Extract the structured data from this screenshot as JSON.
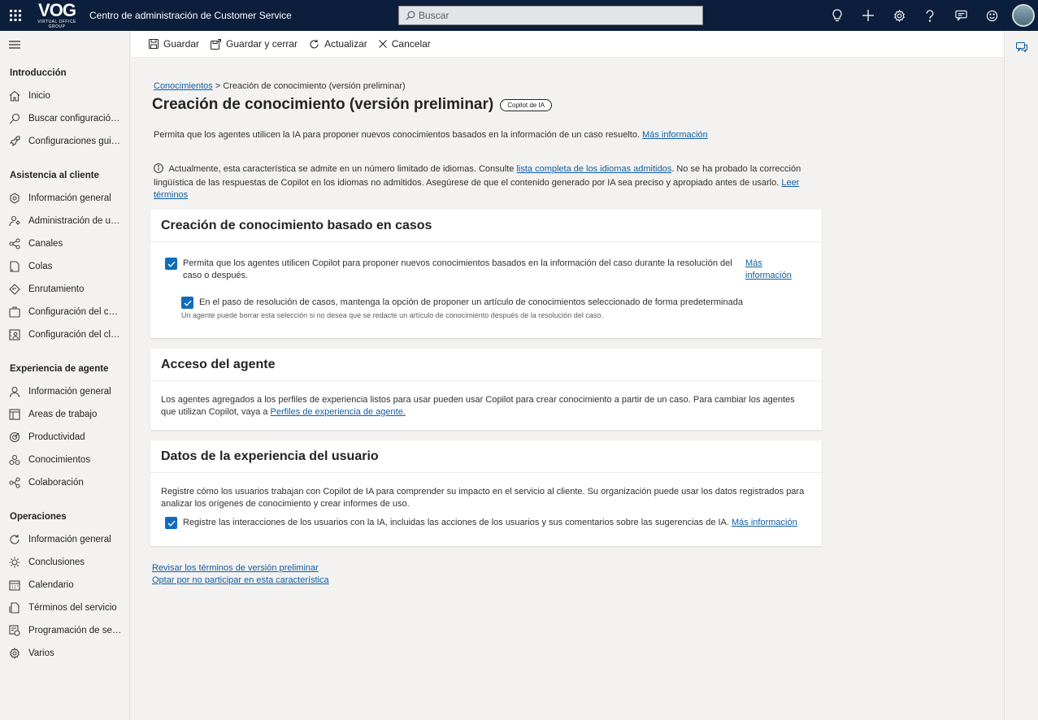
{
  "topbar": {
    "logo_text": "VOG",
    "logo_sub": "VIRTUAL OFFICE GROUP",
    "app_title": "Centro de administración de Customer Service",
    "search_placeholder": "Buscar",
    "icons": [
      "lightbulb-icon",
      "plus-icon",
      "gear-icon",
      "help-icon",
      "chat-icon",
      "smiley-icon"
    ]
  },
  "sidebar": {
    "groups": [
      {
        "title": "Introducción",
        "items": [
          {
            "label": "Inicio",
            "icon": "home-icon"
          },
          {
            "label": "Buscar configuración…",
            "icon": "search-icon"
          },
          {
            "label": "Configuraciones guiadas",
            "icon": "rocket-icon"
          }
        ]
      },
      {
        "title": "Asistencia al cliente",
        "items": [
          {
            "label": "Información general",
            "icon": "overview-icon"
          },
          {
            "label": "Administración de usuarios",
            "icon": "users-icon"
          },
          {
            "label": "Canales",
            "icon": "channels-icon"
          },
          {
            "label": "Colas",
            "icon": "queue-icon"
          },
          {
            "label": "Enrutamiento",
            "icon": "routing-icon"
          },
          {
            "label": "Configuración del caso",
            "icon": "case-icon"
          },
          {
            "label": "Configuración del cliente",
            "icon": "customer-icon"
          }
        ]
      },
      {
        "title": "Experiencia de agente",
        "items": [
          {
            "label": "Información general",
            "icon": "person-icon"
          },
          {
            "label": "Áreas de trabajo",
            "icon": "workspace-icon"
          },
          {
            "label": "Productividad",
            "icon": "productivity-icon"
          },
          {
            "label": "Conocimientos",
            "icon": "knowledge-icon"
          },
          {
            "label": "Colaboración",
            "icon": "collaboration-icon"
          }
        ]
      },
      {
        "title": "Operaciones",
        "items": [
          {
            "label": "Información general",
            "icon": "refresh-icon"
          },
          {
            "label": "Conclusiones",
            "icon": "insights-icon"
          },
          {
            "label": "Calendario",
            "icon": "calendar-icon"
          },
          {
            "label": "Términos del servicio",
            "icon": "terms-icon"
          },
          {
            "label": "Programación de servicios",
            "icon": "schedule-icon"
          },
          {
            "label": "Varios",
            "icon": "misc-icon"
          }
        ]
      }
    ]
  },
  "commandbar": {
    "save": "Guardar",
    "save_close": "Guardar y cerrar",
    "refresh": "Actualizar",
    "cancel": "Cancelar"
  },
  "main": {
    "breadcrumb_link": "Conocimientos",
    "breadcrumb_sep": ">",
    "breadcrumb_current": "Creación de conocimiento (versión preliminar)",
    "title": "Creación de conocimiento (versión preliminar)",
    "badge": "Copilot de IA",
    "description": "Permita que los agentes utilicen la IA para proponer nuevos conocimientos basados en la información de un caso resuelto.",
    "description_link": "Más información",
    "notice_a": "Actualmente, esta característica se admite en un número limitado de idiomas. Consulte",
    "notice_link1": "lista completa de los idiomas admitidos",
    "notice_b": ". No se ha probado la corrección lingüística de las respuestas de Copilot en los idiomas no admitidos. Asegúrese de que el contenido generado por IA sea preciso y apropiado antes de usarlo.",
    "notice_link2": "Leer términos"
  },
  "card1": {
    "title": "Creación de conocimiento basado en casos",
    "check1_text": "Permita que los agentes utilicen Copilot para proponer nuevos conocimientos basados en la información del caso durante la resolución del caso o después.",
    "check1_link": "Más información",
    "check1_checked": true,
    "check2_text": "En el paso de resolución de casos, mantenga la opción de proponer un artículo de conocimientos seleccionado de forma predeterminada",
    "check2_checked": true,
    "check2_hint": "Un agente puede borrar esta selección si no desea que se redacte un artículo de conocimiento después de la resolución del caso."
  },
  "card2": {
    "title": "Acceso del agente",
    "text": "Los agentes agregados a los perfiles de experiencia listos para usar pueden usar Copilot para crear conocimiento a partir de un caso. Para cambiar los agentes que utilizan Copilot, vaya a",
    "link": "Perfiles de experiencia de agente."
  },
  "card3": {
    "title": "Datos de la experiencia del usuario",
    "text": "Registre cómo los usuarios trabajan con Copilot de IA para comprender su impacto en el servicio al cliente. Su organización puede usar los datos registrados para analizar los orígenes de conocimiento y crear informes de uso.",
    "check_text": "Registre las interacciones de los usuarios con la IA, incluidas las acciones de los usuarios y sus comentarios sobre las sugerencias de IA.",
    "check_link": "Más información",
    "check_checked": true
  },
  "footer": {
    "link1": "Revisar los términos de versión preliminar",
    "link2": "Optar por no participar en esta característica"
  },
  "colors": {
    "topbar": "#0b1e3b",
    "accent": "#0f6cbd",
    "link": "#115ea3"
  }
}
